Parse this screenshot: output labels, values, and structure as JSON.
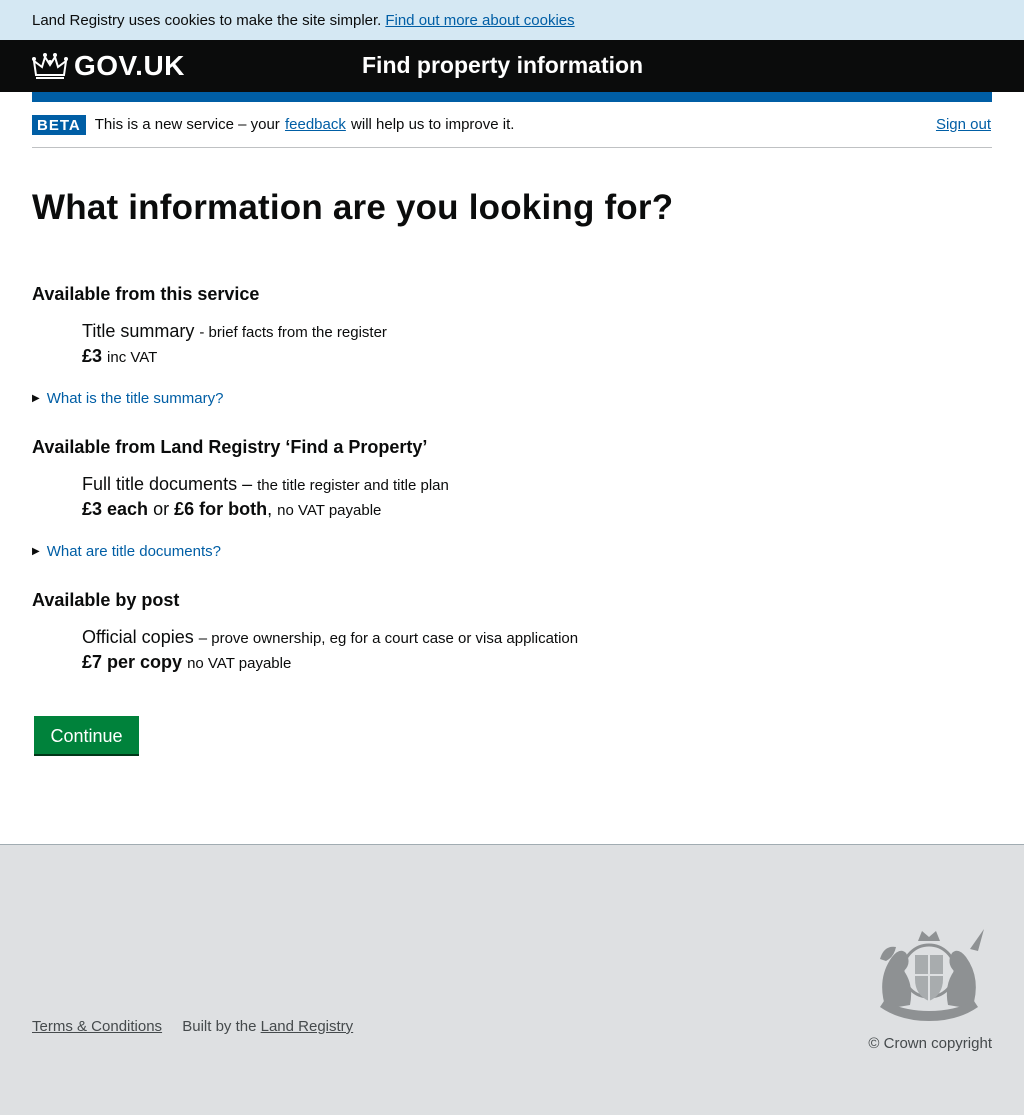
{
  "cookie_banner": {
    "text": "Land Registry uses cookies to make the site simpler.",
    "link": "Find out more about cookies"
  },
  "header": {
    "logo_text": "GOV.UK",
    "service_name": "Find property information"
  },
  "phase_banner": {
    "tag": "BETA",
    "text_before": "This is a new service – your",
    "feedback_link": "feedback",
    "text_after": "will help us to improve it.",
    "sign_out": "Sign out"
  },
  "main": {
    "title": "What information are you looking for?",
    "sections": [
      {
        "heading": "Available from this service",
        "item_name": "Title summary",
        "item_desc": "- brief facts from the register",
        "price": "£3",
        "price_note": "inc VAT",
        "details": "What is the title summary?"
      },
      {
        "heading": "Available from Land Registry ‘Find a Property’",
        "item_name": "Full title documents –",
        "item_desc": "the title register and title plan",
        "price_each": "£3 each",
        "or": "or",
        "price_both": "£6 for both",
        "comma": ",",
        "price_note": "no VAT payable",
        "details": "What are title documents?"
      },
      {
        "heading": "Available by post",
        "item_name": "Official copies",
        "item_desc": "– prove ownership, eg for a court case or visa application",
        "price": "£7 per copy",
        "price_note": "no VAT payable"
      }
    ],
    "continue_label": "Continue"
  },
  "footer": {
    "terms": "Terms & Conditions",
    "built_by": "Built by the",
    "land_registry": "Land Registry",
    "copyright": "© Crown copyright"
  }
}
